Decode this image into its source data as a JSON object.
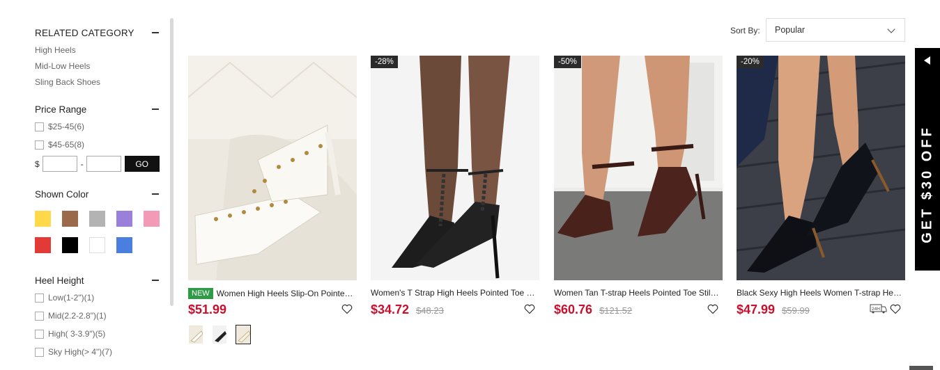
{
  "sidebar": {
    "related_category": {
      "title": "RELATED CATEGORY",
      "items": [
        "High Heels",
        "Mid-Low Heels",
        "Sling Back Shoes"
      ]
    },
    "price_range": {
      "title": "Price Range",
      "options": [
        "$25-45(6)",
        "$45-65(8)"
      ],
      "currency": "$",
      "separator": "-",
      "go_label": "GO"
    },
    "shown_color": {
      "title": "Shown Color",
      "colors": [
        "#ffd94a",
        "#9b6a4b",
        "#b3b3b3",
        "#9a7fdb",
        "#f39bb6",
        "#e23a36",
        "#000000",
        "#ffffff",
        "#4a7fe0"
      ]
    },
    "heel_height": {
      "title": "Heel Height",
      "options": [
        "Low(1-2\")(1)",
        "Mid(2.2-2.8\")(1)",
        "High( 3-3.9\")(5)",
        "Sky High(> 4\")(7)"
      ]
    }
  },
  "sort": {
    "label": "Sort By:",
    "value": "Popular"
  },
  "products": [
    {
      "badge": "",
      "new_tag": "NEW",
      "title": "Women High Heels Slip-On Pointed Toe Studded T-strap Stiletto Heels",
      "price": "$51.99",
      "old_price": ""
    },
    {
      "badge": "-28%",
      "new_tag": "",
      "title": "Women's T Strap High Heels Pointed Toe Stiletto Chain Pumps",
      "price": "$34.72",
      "old_price": "$48.23"
    },
    {
      "badge": "-50%",
      "new_tag": "",
      "title": "Women Tan T-strap Heels Pointed Toe Stiletto Pumps",
      "price": "$60.76",
      "old_price": "$121.52"
    },
    {
      "badge": "-20%",
      "new_tag": "",
      "title": "Black Sexy High Heels Women T-strap Heels Pumps",
      "price": "$47.99",
      "old_price": "$59.99",
      "ship_label": "24H"
    }
  ],
  "promo": {
    "text": "GET $30 OFF"
  },
  "colors": {
    "price": "#c8102e",
    "new_tag": "#2f9a48",
    "badge": "#2b2b2b",
    "promo": "#000000"
  },
  "icons": [
    "collapse-icon",
    "chevron-down-icon",
    "heart-icon",
    "shipping-24h-icon",
    "arrow-left-icon"
  ]
}
